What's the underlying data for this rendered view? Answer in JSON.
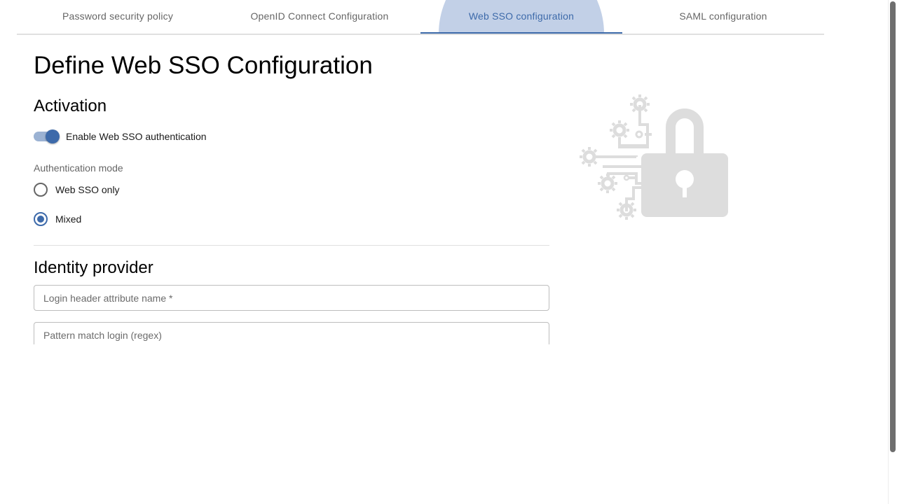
{
  "tabs": [
    {
      "label": "Password security policy",
      "active": false
    },
    {
      "label": "OpenID Connect Configuration",
      "active": false
    },
    {
      "label": "Web SSO configuration",
      "active": true
    },
    {
      "label": "SAML configuration",
      "active": false
    }
  ],
  "page_title": "Define Web SSO Configuration",
  "activation": {
    "title": "Activation",
    "toggle_label": "Enable Web SSO authentication",
    "toggle_on": true,
    "auth_mode_caption": "Authentication mode",
    "options": [
      {
        "label": "Web SSO only",
        "checked": false
      },
      {
        "label": "Mixed",
        "checked": true
      }
    ]
  },
  "identity_provider": {
    "title": "Identity provider",
    "login_header_placeholder": "Login header attribute name *",
    "pattern_match_placeholder": "Pattern match login (regex)"
  },
  "illustration": {
    "icon": "lock-with-gears-icon"
  },
  "colors": {
    "accent": "#3d6aaa",
    "tab_ripple": "#c2d0e7",
    "illustration_gray": "#dddddd"
  }
}
